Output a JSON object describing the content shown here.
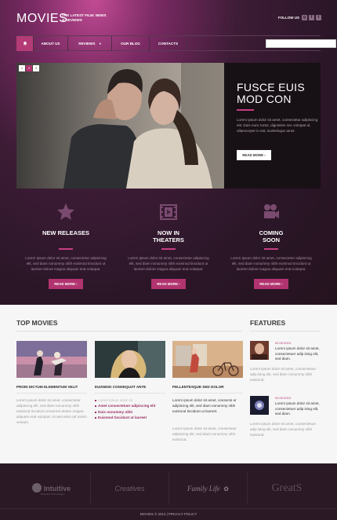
{
  "header": {
    "logo": "MOVIES",
    "tagline": "THE LATEST FILM: NEWS & REVIEWS",
    "follow_label": "FOLLOW US",
    "social": [
      "g",
      "f",
      "t"
    ]
  },
  "nav": {
    "home_icon": "home-icon",
    "items": [
      "ABOUT US",
      "REVIEWS",
      "OUR BLOG",
      "CONTACTS"
    ],
    "search_placeholder": ""
  },
  "slider": {
    "pages": [
      "1",
      "2",
      "3"
    ],
    "title": "FUSCE EUIS MOD CON",
    "text": "Lorem ipsum dolor sit amet, consectetur adipiscing elit. Duis nunc tortor, dignissim nec volutpat id, ullamcorper in est, scelerisque amet.",
    "button": "READ MORE ›"
  },
  "features": [
    {
      "title": "NEW RELEASES",
      "icon": "star-icon",
      "text": "Lorem ipsum dolor sit amet, consectetur adipiscing elit, sed diam nonummy nibh euismod tincidunt ut laoreet dolore magna aliquam erat volutpat.",
      "button": "READ MORE ›"
    },
    {
      "title": "NOW IN THEATERS",
      "icon": "film-icon",
      "text": "Lorem ipsum dolor sit amet, consectetur adipiscing elit, sed diam nonummy nibh euismod tincidunt ut laoreet dolore magna aliquam erat volutpat.",
      "button": "READ MORE ›"
    },
    {
      "title": "COMING SOON",
      "icon": "camera-icon",
      "text": "Lorem ipsum dolor sit amet, consectetur adipiscing elit, sed diam nonummy nibh euismod tincidunt ut laoreet dolore magna aliquam erat volutpat.",
      "button": "READ MORE ›"
    }
  ],
  "top_movies": {
    "heading": "TOP MOVIES",
    "items": [
      {
        "title": "PROIN DICTUM ELEMENTUM VELIT",
        "text": "Lorem ipsum dolor sit amet, consectetur adipiscing elit, sed diam nonummy nibh euismod tincidunt ut laoreet dolore magna aliquam erat volutpat. Ut wisi enim ad minim veniam.",
        "button": "READ MORE ›"
      },
      {
        "title": "EUISMOD CONSEQUAT ANTE",
        "list": [
          "Lorem ipsum dolor sit",
          "Amet consectetuer adipiscing elit",
          "Duis nonummy nibh",
          "Euismod tincidunt ut laoreet"
        ],
        "button": "READ MORE ›"
      },
      {
        "title": "PELLENTESQUE SED DOLOR",
        "lead": "Lorem ipsum dolor sit amet, consecte er adipiscing elit, sed diam nonummy nibh euismod tincidunt ut laoreet.",
        "text": "Lorem ipsum dolor sit amet, consectetur adipiscing elit, sed diam nonummy nibh euismod.",
        "button": "READ MORE ›"
      }
    ]
  },
  "features_side": {
    "heading": "FEATURES",
    "items": [
      {
        "date": "02.03.2013",
        "title": "Lorem ipsum dolor sit amet, consectetuer adip ising elit, sed diam.",
        "text": "Lorem ipsum dolor sit amet, consectetuer adip ising elit, sed diam nonummy nibh euismod."
      },
      {
        "date": "02.03.2013",
        "title": "Lorem ipsum dolor sit amet, consectetuer adip ising elit, sed diam.",
        "text": "Lorem ipsum dolor sit amet, consectetuer adip ising elit, sed diam nonummy nibh euismod."
      }
    ]
  },
  "footer": {
    "partners": [
      "Intuitive",
      "Creatives",
      "Family Life",
      "GreatS"
    ],
    "partner_sub": "Business Technologies",
    "copyright": "MOVIES © 2013 | PRIVACY POLICY"
  }
}
